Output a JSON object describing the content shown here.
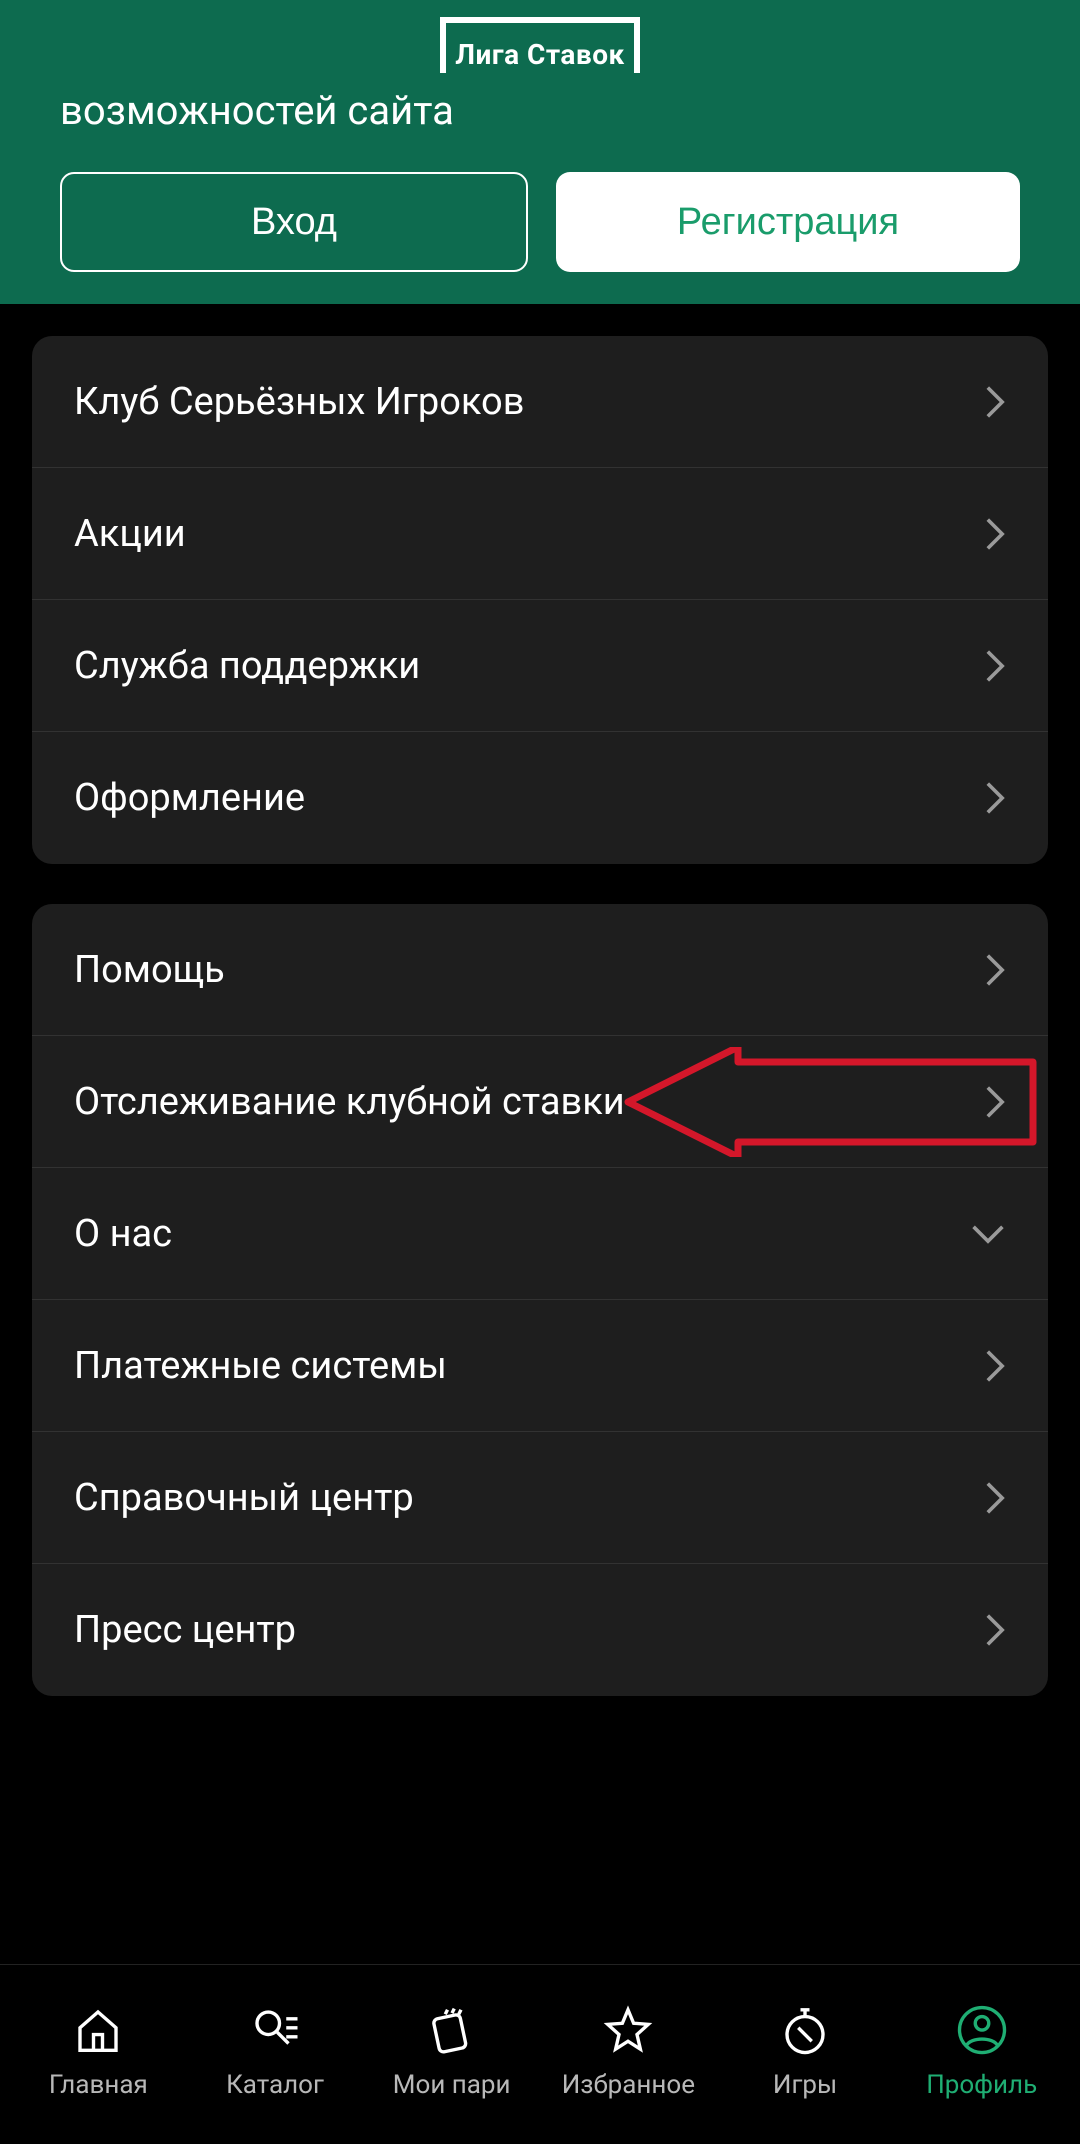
{
  "logo_text": "Лига Ставок",
  "banner": {
    "text_partial": "возможностей сайта",
    "login_label": "Вход",
    "register_label": "Регистрация"
  },
  "menu_group1": [
    {
      "label": "Клуб Серьёзных Игроков",
      "chevron": "right"
    },
    {
      "label": "Акции",
      "chevron": "right"
    },
    {
      "label": "Служба поддержки",
      "chevron": "right"
    },
    {
      "label": "Оформление",
      "chevron": "right"
    }
  ],
  "menu_group2": [
    {
      "label": "Помощь",
      "chevron": "right"
    },
    {
      "label": "Отслеживание клубной ставки",
      "chevron": "right",
      "highlighted": true
    },
    {
      "label": "О нас",
      "chevron": "down"
    },
    {
      "label": "Платежные системы",
      "chevron": "right"
    },
    {
      "label": "Справочный центр",
      "chevron": "right"
    },
    {
      "label": "Пресс центр",
      "chevron": "right"
    }
  ],
  "nav": [
    {
      "key": "home",
      "label": "Главная",
      "active": false
    },
    {
      "key": "catalog",
      "label": "Каталог",
      "active": false
    },
    {
      "key": "mybets",
      "label": "Мои пари",
      "active": false
    },
    {
      "key": "favorite",
      "label": "Избранное",
      "active": false
    },
    {
      "key": "games",
      "label": "Игры",
      "active": false
    },
    {
      "key": "profile",
      "label": "Профиль",
      "active": true
    }
  ]
}
